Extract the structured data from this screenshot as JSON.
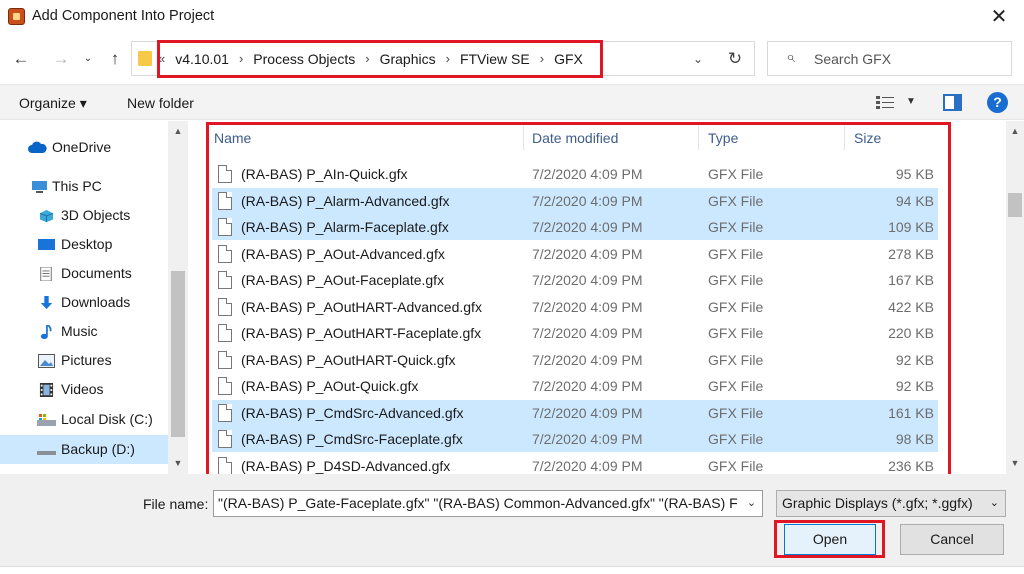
{
  "window": {
    "title": "Add Component Into Project"
  },
  "address": {
    "crumbs": [
      "v4.10.01",
      "Process Objects",
      "Graphics",
      "FTView SE",
      "GFX"
    ]
  },
  "search": {
    "placeholder": "Search GFX"
  },
  "toolbar": {
    "organize": "Organize ▾",
    "new_folder": "New folder"
  },
  "sidebar": {
    "items": [
      {
        "label": "OneDrive",
        "icon": "cloud-icon"
      },
      {
        "label": "This PC",
        "icon": "computer-icon"
      },
      {
        "label": "3D Objects",
        "icon": "cube-icon"
      },
      {
        "label": "Desktop",
        "icon": "desktop-icon"
      },
      {
        "label": "Documents",
        "icon": "document-icon"
      },
      {
        "label": "Downloads",
        "icon": "download-arrow-icon"
      },
      {
        "label": "Music",
        "icon": "music-note-icon"
      },
      {
        "label": "Pictures",
        "icon": "picture-icon"
      },
      {
        "label": "Videos",
        "icon": "film-icon"
      },
      {
        "label": "Local Disk (C:)",
        "icon": "drive-icon"
      },
      {
        "label": "Backup (D:)",
        "icon": "drive-icon"
      }
    ]
  },
  "columns": {
    "name": "Name",
    "date": "Date modified",
    "type": "Type",
    "size": "Size"
  },
  "files": [
    {
      "name": "(RA-BAS) P_AIn-Quick.gfx",
      "date": "7/2/2020 4:09 PM",
      "type": "GFX File",
      "size": "95 KB",
      "selected": false
    },
    {
      "name": "(RA-BAS) P_Alarm-Advanced.gfx",
      "date": "7/2/2020 4:09 PM",
      "type": "GFX File",
      "size": "94 KB",
      "selected": true
    },
    {
      "name": "(RA-BAS) P_Alarm-Faceplate.gfx",
      "date": "7/2/2020 4:09 PM",
      "type": "GFX File",
      "size": "109 KB",
      "selected": true
    },
    {
      "name": "(RA-BAS) P_AOut-Advanced.gfx",
      "date": "7/2/2020 4:09 PM",
      "type": "GFX File",
      "size": "278 KB",
      "selected": false
    },
    {
      "name": "(RA-BAS) P_AOut-Faceplate.gfx",
      "date": "7/2/2020 4:09 PM",
      "type": "GFX File",
      "size": "167 KB",
      "selected": false
    },
    {
      "name": "(RA-BAS) P_AOutHART-Advanced.gfx",
      "date": "7/2/2020 4:09 PM",
      "type": "GFX File",
      "size": "422 KB",
      "selected": false
    },
    {
      "name": "(RA-BAS) P_AOutHART-Faceplate.gfx",
      "date": "7/2/2020 4:09 PM",
      "type": "GFX File",
      "size": "220 KB",
      "selected": false
    },
    {
      "name": "(RA-BAS) P_AOutHART-Quick.gfx",
      "date": "7/2/2020 4:09 PM",
      "type": "GFX File",
      "size": "92 KB",
      "selected": false
    },
    {
      "name": "(RA-BAS) P_AOut-Quick.gfx",
      "date": "7/2/2020 4:09 PM",
      "type": "GFX File",
      "size": "92 KB",
      "selected": false
    },
    {
      "name": "(RA-BAS) P_CmdSrc-Advanced.gfx",
      "date": "7/2/2020 4:09 PM",
      "type": "GFX File",
      "size": "161 KB",
      "selected": true
    },
    {
      "name": "(RA-BAS) P_CmdSrc-Faceplate.gfx",
      "date": "7/2/2020 4:09 PM",
      "type": "GFX File",
      "size": "98 KB",
      "selected": true
    },
    {
      "name": "(RA-BAS) P_D4SD-Advanced.gfx",
      "date": "7/2/2020 4:09 PM",
      "type": "GFX File",
      "size": "236 KB",
      "selected": false
    }
  ],
  "footer": {
    "file_name_label": "File name:",
    "file_name_value": "\"(RA-BAS) P_Gate-Faceplate.gfx\" \"(RA-BAS) Common-Advanced.gfx\" \"(RA-BAS) F",
    "filter": "Graphic Displays (*.gfx; *.ggfx)",
    "open": "Open",
    "cancel": "Cancel"
  },
  "colors": {
    "selection": "#cce8ff",
    "highlight": "#e01624",
    "accent": "#0078d7"
  }
}
